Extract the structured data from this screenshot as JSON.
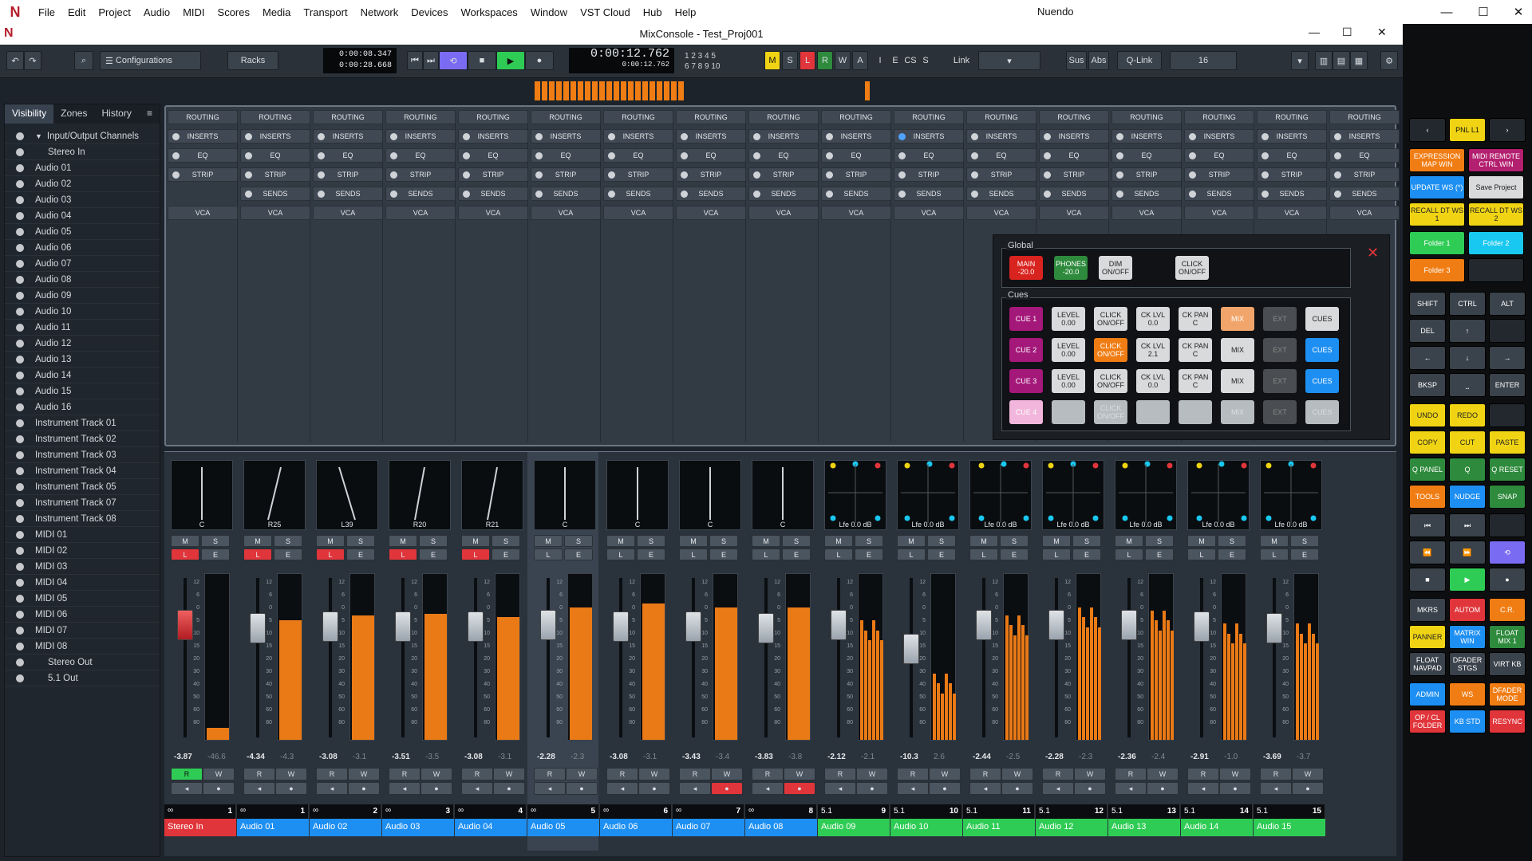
{
  "app": {
    "logo_glyph": "N",
    "menu": [
      "File",
      "Edit",
      "Project",
      "Audio",
      "MIDI",
      "Scores",
      "Media",
      "Transport",
      "Network",
      "Devices",
      "Workspaces",
      "Window",
      "VST Cloud",
      "Hub",
      "Help"
    ],
    "title": "Nuendo"
  },
  "window": {
    "title": "MixConsole - Test_Proj001"
  },
  "toolbar": {
    "configurations": "Configurations",
    "racks": "Racks",
    "time_primary": "0:00:08.347",
    "time_secondary": "0:00:28.668",
    "big_time": "0:00:12.762",
    "big_time_small": "0:00:12.762",
    "mslrwa": [
      "M",
      "S",
      "L",
      "R",
      "W",
      "A"
    ],
    "ie": [
      "I",
      "E",
      "CS",
      "S"
    ],
    "link": "Link",
    "sus": "Sus",
    "abs": "Abs",
    "qlink": "Q-Link",
    "count": "16",
    "counter_top": "1 2 3 4 5",
    "counter_bot": "6 7 8 9 10"
  },
  "left": {
    "tabs": [
      "Visibility",
      "Zones",
      "History"
    ],
    "items": [
      {
        "label": "Input/Output Channels",
        "indent": 1
      },
      {
        "label": "Stereo In",
        "indent": 2
      },
      {
        "label": "Audio 01"
      },
      {
        "label": "Audio 02"
      },
      {
        "label": "Audio 03"
      },
      {
        "label": "Audio 04"
      },
      {
        "label": "Audio 05"
      },
      {
        "label": "Audio 06"
      },
      {
        "label": "Audio 07"
      },
      {
        "label": "Audio 08"
      },
      {
        "label": "Audio 09"
      },
      {
        "label": "Audio 10"
      },
      {
        "label": "Audio 11"
      },
      {
        "label": "Audio 12"
      },
      {
        "label": "Audio 13"
      },
      {
        "label": "Audio 14"
      },
      {
        "label": "Audio 15"
      },
      {
        "label": "Audio 16"
      },
      {
        "label": "Instrument Track 01"
      },
      {
        "label": "Instrument Track 02"
      },
      {
        "label": "Instrument Track 03"
      },
      {
        "label": "Instrument Track 04"
      },
      {
        "label": "Instrument Track 05"
      },
      {
        "label": "Instrument Track 07"
      },
      {
        "label": "Instrument Track 08"
      },
      {
        "label": "MIDI 01"
      },
      {
        "label": "MIDI 02"
      },
      {
        "label": "MIDI 03"
      },
      {
        "label": "MIDI 04"
      },
      {
        "label": "MIDI 05"
      },
      {
        "label": "MIDI 06"
      },
      {
        "label": "MIDI 07"
      },
      {
        "label": "MIDI 08"
      },
      {
        "label": "Stereo Out",
        "indent": 2
      },
      {
        "label": "5.1 Out",
        "indent": 2
      }
    ]
  },
  "rack_sections": [
    "ROUTING",
    "INSERTS",
    "EQ",
    "STRIP",
    "SENDS",
    "VCA"
  ],
  "controlroom": {
    "global_label": "Global",
    "cues_label": "Cues",
    "global": [
      {
        "l1": "MAIN",
        "l2": "-20.0",
        "color": "#d8231f",
        "fg": "#fff"
      },
      {
        "l1": "PHONES",
        "l2": "-20.0",
        "color": "#2e8a3c",
        "fg": "#fff"
      },
      {
        "l1": "DIM",
        "l2": "ON/OFF",
        "color": "#d8dadc",
        "fg": "#222"
      },
      {
        "l1": "CLICK",
        "l2": "ON/OFF",
        "color": "#d8dadc",
        "fg": "#222"
      }
    ],
    "cues": [
      [
        {
          "l1": "CUE 1",
          "color": "#a4187a",
          "fg": "#fff"
        },
        {
          "l1": "LEVEL",
          "l2": "0.00",
          "color": "#d8dadc"
        },
        {
          "l1": "CLICK",
          "l2": "ON/OFF",
          "color": "#d8dadc"
        },
        {
          "l1": "CK LVL",
          "l2": "0.0",
          "color": "#d8dadc"
        },
        {
          "l1": "CK PAN",
          "l2": "C",
          "color": "#d8dadc"
        },
        {
          "l1": "MIX",
          "color": "#f2a56a",
          "fg": "#fff"
        },
        {
          "l1": "EXT",
          "color": "#4a4d51",
          "fg": "#888"
        },
        {
          "l1": "CUES",
          "color": "#d8dadc"
        }
      ],
      [
        {
          "l1": "CUE 2",
          "color": "#a4187a",
          "fg": "#fff"
        },
        {
          "l1": "LEVEL",
          "l2": "0.00",
          "color": "#d8dadc"
        },
        {
          "l1": "CLICK",
          "l2": "ON/OFF",
          "color": "#f07d14",
          "fg": "#fff"
        },
        {
          "l1": "CK LVL",
          "l2": "2.1",
          "color": "#d8dadc"
        },
        {
          "l1": "CK PAN",
          "l2": "C",
          "color": "#d8dadc"
        },
        {
          "l1": "MIX",
          "color": "#d8dadc"
        },
        {
          "l1": "EXT",
          "color": "#4a4d51",
          "fg": "#888"
        },
        {
          "l1": "CUES",
          "color": "#1e8ff2",
          "fg": "#fff"
        }
      ],
      [
        {
          "l1": "CUE 3",
          "color": "#a4187a",
          "fg": "#fff"
        },
        {
          "l1": "LEVEL",
          "l2": "0.00",
          "color": "#d8dadc"
        },
        {
          "l1": "CLICK",
          "l2": "ON/OFF",
          "color": "#d8dadc"
        },
        {
          "l1": "CK LVL",
          "l2": "0.0",
          "color": "#d8dadc"
        },
        {
          "l1": "CK PAN",
          "l2": "C",
          "color": "#d8dadc"
        },
        {
          "l1": "MIX",
          "color": "#d8dadc"
        },
        {
          "l1": "EXT",
          "color": "#4a4d51",
          "fg": "#888"
        },
        {
          "l1": "CUES",
          "color": "#1e8ff2",
          "fg": "#fff"
        }
      ],
      [
        {
          "l1": "CUE 4",
          "color": "#f2b6dc",
          "fg": "#fff"
        },
        {
          "l1": "",
          "color": "#b7bcc1"
        },
        {
          "l1": "CLICK",
          "l2": "ON/OFF",
          "color": "#b7bcc1",
          "fg": "#ddd"
        },
        {
          "l1": "",
          "color": "#b7bcc1"
        },
        {
          "l1": "",
          "color": "#b7bcc1"
        },
        {
          "l1": "MIX",
          "color": "#b7bcc1",
          "fg": "#ddd"
        },
        {
          "l1": "EXT",
          "color": "#4a4d51",
          "fg": "#888"
        },
        {
          "l1": "CUES",
          "color": "#b7bcc1",
          "fg": "#ddd"
        }
      ]
    ]
  },
  "mixer": {
    "scale": [
      "12",
      "6",
      "0",
      "5",
      "10",
      "15",
      "20",
      "30",
      "40",
      "50",
      "60",
      "80"
    ],
    "channels": [
      {
        "name": "Stereo In",
        "num": "1",
        "pan": "C",
        "vol": "-3.87",
        "peak": "-46.6",
        "L": true,
        "R_active": true,
        "color": "#e0353b",
        "type": "st",
        "fader": 0.2,
        "meter": 0.07
      },
      {
        "name": "Audio 01",
        "num": "1",
        "pan": "R25",
        "vol": "-4.34",
        "peak": "-4.3",
        "L": true,
        "color": "#1e8ff2",
        "type": "st",
        "fader": 0.22,
        "meter": 0.72
      },
      {
        "name": "Audio 02",
        "num": "2",
        "pan": "L39",
        "vol": "-3.08",
        "peak": "-3.1",
        "L": true,
        "color": "#1e8ff2",
        "type": "st",
        "fader": 0.21,
        "meter": 0.75
      },
      {
        "name": "Audio 03",
        "num": "3",
        "pan": "R20",
        "vol": "-3.51",
        "peak": "-3.5",
        "L": true,
        "color": "#1e8ff2",
        "type": "st",
        "fader": 0.21,
        "meter": 0.76
      },
      {
        "name": "Audio 04",
        "num": "4",
        "pan": "R21",
        "vol": "-3.08",
        "peak": "-3.1",
        "L": true,
        "color": "#1e8ff2",
        "type": "st",
        "fader": 0.21,
        "meter": 0.74
      },
      {
        "name": "Audio 05",
        "num": "5",
        "pan": "C",
        "vol": "-2.28",
        "peak": "-2.3",
        "color": "#1e8ff2",
        "type": "st",
        "fader": 0.2,
        "meter": 0.8,
        "sel": true
      },
      {
        "name": "Audio 06",
        "num": "6",
        "pan": "C",
        "vol": "-3.08",
        "peak": "-3.1",
        "color": "#1e8ff2",
        "type": "st",
        "fader": 0.21,
        "meter": 0.82
      },
      {
        "name": "Audio 07",
        "num": "7",
        "pan": "C",
        "vol": "-3.43",
        "peak": "-3.4",
        "color": "#1e8ff2",
        "type": "st",
        "fader": 0.21,
        "meter": 0.8,
        "rec": true
      },
      {
        "name": "Audio 08",
        "num": "8",
        "pan": "C",
        "vol": "-3.83",
        "peak": "-3.8",
        "color": "#1e8ff2",
        "type": "st",
        "fader": 0.22,
        "meter": 0.8,
        "rec": true
      },
      {
        "name": "Audio 09",
        "num": "9",
        "pan": "Lfe 0.0 dB",
        "vol": "-2.12",
        "peak": "-2.1",
        "color": "#2fcc55",
        "type": "s",
        "fader": 0.2,
        "meter": 0.72
      },
      {
        "name": "Audio 10",
        "num": "10",
        "pan": "Lfe 0.0 dB",
        "vol": "-10.3",
        "peak": "2.6",
        "color": "#2fcc55",
        "type": "s",
        "fader": 0.35,
        "meter": 0.4
      },
      {
        "name": "Audio 11",
        "num": "11",
        "pan": "Lfe 0.0 dB",
        "vol": "-2.44",
        "peak": "-2.5",
        "color": "#2fcc55",
        "type": "s",
        "fader": 0.2,
        "meter": 0.75
      },
      {
        "name": "Audio 12",
        "num": "12",
        "pan": "Lfe 0.0 dB",
        "vol": "-2.28",
        "peak": "-2.3",
        "color": "#2fcc55",
        "type": "s",
        "fader": 0.2,
        "meter": 0.8
      },
      {
        "name": "Audio 13",
        "num": "13",
        "pan": "Lfe 0.0 dB",
        "vol": "-2.36",
        "peak": "-2.4",
        "color": "#2fcc55",
        "type": "s",
        "fader": 0.2,
        "meter": 0.78
      },
      {
        "name": "Audio 14",
        "num": "14",
        "pan": "Lfe 0.0 dB",
        "vol": "-2.91",
        "peak": "-1.0",
        "color": "#2fcc55",
        "type": "s",
        "fader": 0.21,
        "meter": 0.7
      },
      {
        "name": "Audio 15",
        "num": "15",
        "pan": "Lfe 0.0 dB",
        "vol": "-3.69",
        "peak": "-3.7",
        "color": "#2fcc55",
        "type": "s",
        "fader": 0.22,
        "meter": 0.7
      }
    ]
  },
  "labels": {
    "M": "M",
    "S": "S",
    "L": "L",
    "E": "E",
    "R": "R",
    "W": "W",
    "surround": "5.1"
  },
  "remote": {
    "nav": "PNL L1",
    "buttons": [
      {
        "t": "EXPRESSION MAP WIN",
        "c": "#f07d14"
      },
      {
        "t": "MIDI REMOTE CTRL WIN",
        "c": "#b3206f"
      },
      {
        "t": "UPDATE WS (*)",
        "c": "#1e8ff2"
      },
      {
        "t": "Save Project",
        "c": "#d8dadc",
        "fg": "#222"
      },
      {
        "t": "RECALL DT WS 1",
        "c": "#f0d414",
        "fg": "#222"
      },
      {
        "t": "RECALL DT WS 2",
        "c": "#f0d414",
        "fg": "#222"
      },
      {
        "t": "Folder 1",
        "c": "#2fcc55"
      },
      {
        "t": "Folder 2",
        "c": "#19c8f0"
      },
      {
        "t": "Folder 3",
        "c": "#f07d14"
      },
      {
        "t": "",
        "c": "#22282e"
      },
      {
        "t": "SHIFT",
        "c": "#3a424b"
      },
      {
        "t": "CTRL",
        "c": "#3a424b"
      },
      {
        "t": "ALT",
        "c": "#3a424b"
      },
      {
        "t": "DEL",
        "c": "#3a424b"
      },
      {
        "t": "↑",
        "c": "#3a424b"
      },
      {
        "t": "",
        "c": "#22282e"
      },
      {
        "t": "←",
        "c": "#3a424b"
      },
      {
        "t": "↓",
        "c": "#3a424b"
      },
      {
        "t": "→",
        "c": "#3a424b"
      },
      {
        "t": "BKSP",
        "c": "#3a424b"
      },
      {
        "t": "⎵",
        "c": "#3a424b"
      },
      {
        "t": "ENTER",
        "c": "#3a424b"
      },
      {
        "t": "UNDO",
        "c": "#f0d414",
        "fg": "#222"
      },
      {
        "t": "REDO",
        "c": "#f0d414",
        "fg": "#222"
      },
      {
        "t": "",
        "c": "#22282e"
      },
      {
        "t": "COPY",
        "c": "#f0d414",
        "fg": "#222"
      },
      {
        "t": "CUT",
        "c": "#f0d414",
        "fg": "#222"
      },
      {
        "t": "PASTE",
        "c": "#f0d414",
        "fg": "#222"
      },
      {
        "t": "Q PANEL",
        "c": "#2e8a3c"
      },
      {
        "t": "Q",
        "c": "#2e8a3c"
      },
      {
        "t": "Q RESET",
        "c": "#2e8a3c"
      },
      {
        "t": "TOOLS",
        "c": "#f07d14"
      },
      {
        "t": "NUDGE",
        "c": "#1e8ff2"
      },
      {
        "t": "SNAP",
        "c": "#2e8a3c"
      },
      {
        "t": "⏮",
        "c": "#3a424b"
      },
      {
        "t": "⏭",
        "c": "#3a424b"
      },
      {
        "t": "",
        "c": "#22282e"
      },
      {
        "t": "⏪",
        "c": "#3a424b"
      },
      {
        "t": "⏩",
        "c": "#3a424b"
      },
      {
        "t": "⟲",
        "c": "#7a6cf2"
      },
      {
        "t": "■",
        "c": "#3a424b"
      },
      {
        "t": "▶",
        "c": "#2fcc55"
      },
      {
        "t": "●",
        "c": "#3a424b"
      },
      {
        "t": "MKRS",
        "c": "#3a424b"
      },
      {
        "t": "AUTOM",
        "c": "#e0353b"
      },
      {
        "t": "C.R.",
        "c": "#f07d14"
      },
      {
        "t": "PANNER",
        "c": "#f0d414",
        "fg": "#222"
      },
      {
        "t": "MATRIX WIN",
        "c": "#1e8ff2"
      },
      {
        "t": "FLOAT MIX 1",
        "c": "#2e8a3c"
      },
      {
        "t": "FLOAT NAVPAD",
        "c": "#3a424b"
      },
      {
        "t": "DFADER STGS",
        "c": "#3a424b"
      },
      {
        "t": "VIRT KB",
        "c": "#3a424b"
      },
      {
        "t": "ADMIN",
        "c": "#1e8ff2"
      },
      {
        "t": "WS",
        "c": "#f07d14"
      },
      {
        "t": "DFADER MODE",
        "c": "#f07d14"
      },
      {
        "t": "OP / CL FOLDER",
        "c": "#e0353b"
      },
      {
        "t": "KB STD",
        "c": "#1e8ff2"
      },
      {
        "t": "RESYNC",
        "c": "#e0353b"
      }
    ]
  }
}
